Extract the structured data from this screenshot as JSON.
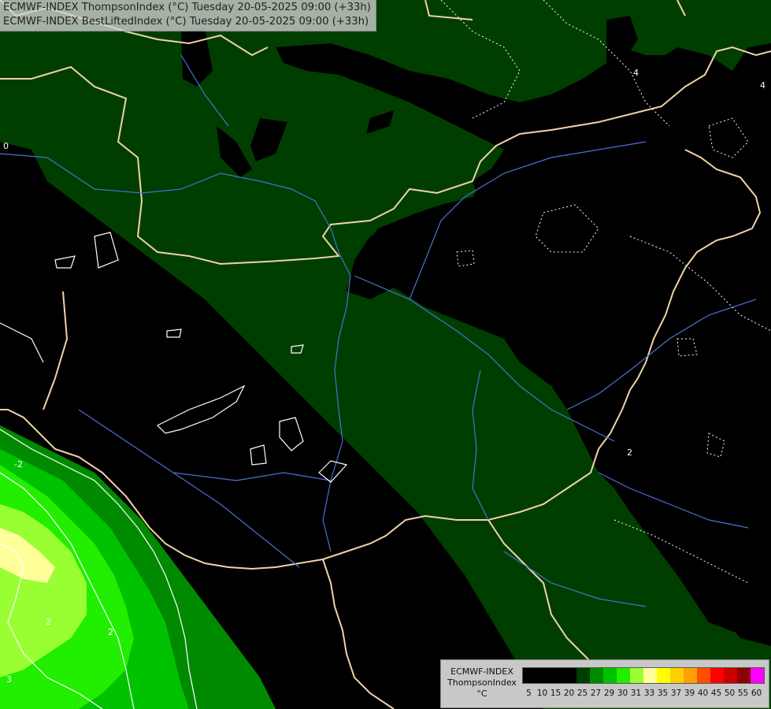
{
  "title": {
    "line1": "ECMWF-INDEX ThompsonIndex (°C) Tuesday 20-05-2025 09:00 (+33h)",
    "line2": "ECMWF-INDEX BestLiftedIndex (°C) Tuesday 20-05-2025 09:00 (+33h)"
  },
  "legend": {
    "source": "ECMWF-INDEX",
    "variable": "ThompsonIndex",
    "unit": "°C",
    "ticks": [
      "5",
      "10",
      "15",
      "20",
      "25",
      "27",
      "29",
      "30",
      "31",
      "33",
      "35",
      "37",
      "39",
      "40",
      "45",
      "50",
      "55",
      "60"
    ],
    "colors": [
      "#000000",
      "#000000",
      "#000000",
      "#000000",
      "#003e00",
      "#008a00",
      "#00c200",
      "#22ee00",
      "#99ff33",
      "#ffff99",
      "#ffff00",
      "#ffd000",
      "#ffa000",
      "#ff5000",
      "#ff0000",
      "#c80000",
      "#8c0000",
      "#ff00ff",
      "#c000ff",
      "#8000ff",
      "#5000ff",
      "#0000ff"
    ]
  },
  "contour_labels": [
    "0",
    "4",
    "2",
    "-2",
    "2",
    "2",
    "3",
    "4"
  ],
  "colors": {
    "class_20_25": "#003e00",
    "class_25_27": "#008a00",
    "class_27_29": "#00c200",
    "class_29_30": "#22ee00",
    "class_30_31": "#99ff33",
    "class_31_33": "#ffff99",
    "border": "#f0d2a8",
    "river": "#4a70d0",
    "contour": "#ffffff"
  }
}
